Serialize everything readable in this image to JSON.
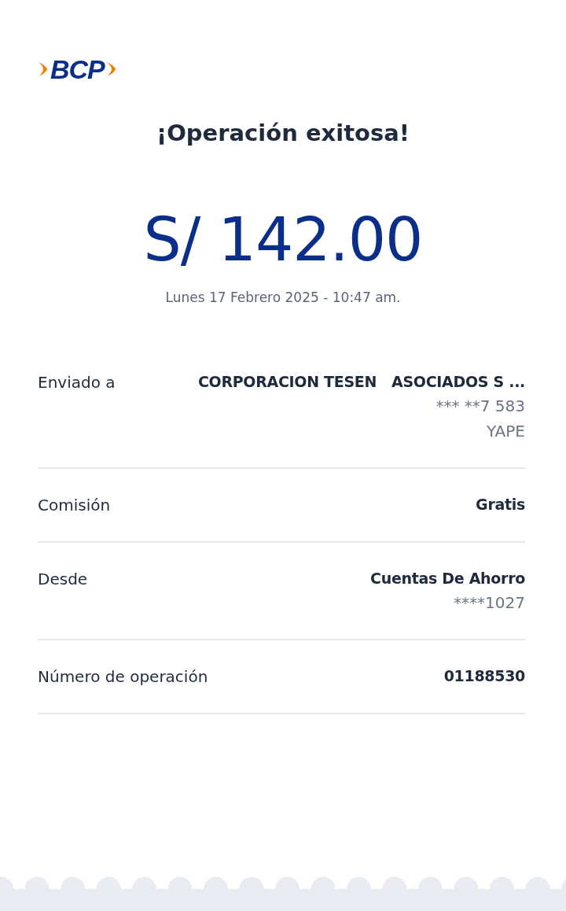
{
  "logo": {
    "text": "BCP"
  },
  "title": "¡Operación exitosa!",
  "amount": "S/ 142.00",
  "datetime": "Lunes 17 Febrero 2025 - 10:47 am.",
  "details": [
    {
      "label": "Enviado a",
      "value": "CORPORACION TESEN   ASOCIADOS S ...",
      "extra": [
        "*** **7 583",
        "YAPE"
      ]
    },
    {
      "label": "Comisión",
      "value": "Gratis"
    },
    {
      "label": "Desde",
      "value": "Cuentas De Ahorro",
      "extra": [
        "****1027"
      ]
    },
    {
      "label": "Número de operación",
      "value": "01188530"
    }
  ]
}
